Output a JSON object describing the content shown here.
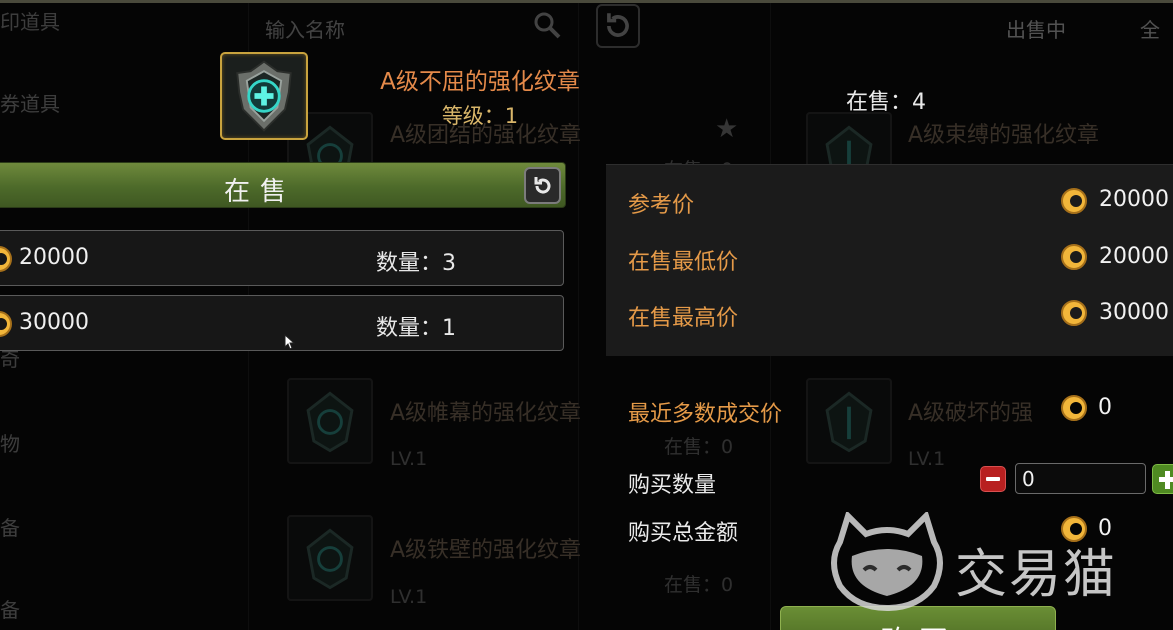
{
  "background": {
    "search_placeholder": "输入名称",
    "status_filter": "出售中",
    "filter_all": "全",
    "left_categories": [
      "印道具",
      "券道具",
      "奇",
      "物",
      "备",
      "备"
    ],
    "cards": [
      {
        "name": "A级团结的强化纹章",
        "sub1": "在售：0"
      },
      {
        "name": "A级束缚的强化纹章",
        "sub1": ""
      },
      {
        "name": "A级帷幕的强化纹章",
        "sub1": "在售：0",
        "sub2": "LV.1"
      },
      {
        "name": "A级破坏的强",
        "sub1": "",
        "sub2": "LV.1"
      },
      {
        "name": "A级铁壁的强化纹章",
        "sub1": "在售：0",
        "sub2": "LV.1"
      }
    ]
  },
  "item": {
    "title": "A级不屈的强化纹章",
    "level": "等级：1",
    "on_sale_count": "在售：4",
    "icon": "shield-emblem-icon"
  },
  "sale_section": {
    "title": "在售",
    "refresh_icon": "refresh-icon",
    "listings": [
      {
        "price": "20000",
        "quantity": "数量：3"
      },
      {
        "price": "30000",
        "quantity": "数量：1"
      }
    ]
  },
  "price_info": {
    "reference_label": "参考价",
    "reference_value": "20000",
    "min_label": "在售最低价",
    "min_value": "20000",
    "max_label": "在售最高价",
    "max_value": "30000",
    "recent_label": "最近多数成交价",
    "recent_value": "0",
    "quantity_label": "购买数量",
    "quantity_value": "0",
    "total_label": "购买总金额",
    "total_value": "0",
    "currency_icon": "gold-coin-icon"
  },
  "buy_button": "购买",
  "watermark_text": "交易猫",
  "colors": {
    "title_orange": "#e58a4a",
    "label_orange": "#e59a48",
    "bar_green": "#4d6a2a",
    "coin_gold": "#f2b63a"
  }
}
